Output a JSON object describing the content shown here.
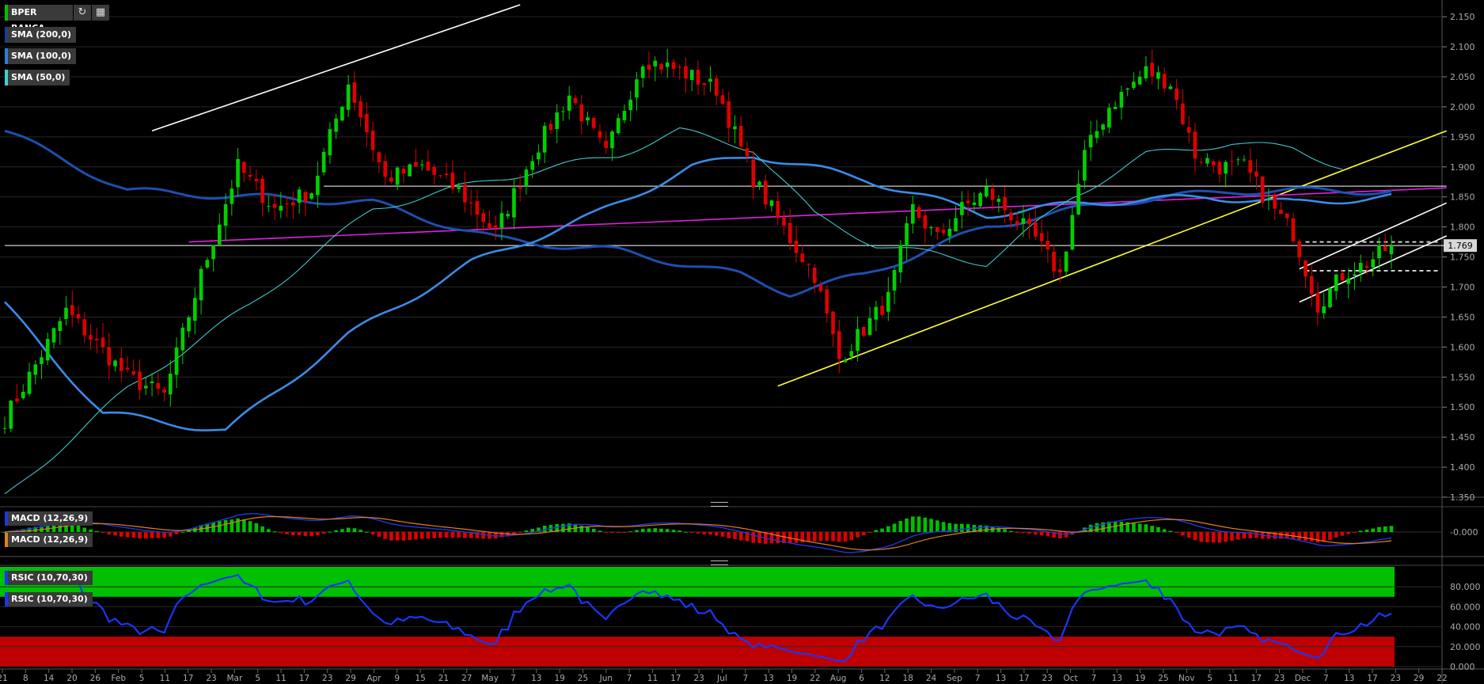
{
  "instrument": {
    "name": "BPER BANCA",
    "color": "#00c000",
    "current_price_label": "1.769",
    "refresh_icon": "refresh-icon",
    "calendar_icon": "calendar-icon"
  },
  "overlays": [
    {
      "label": "SMA (200,0)",
      "color": "#1e3f8a"
    },
    {
      "label": "SMA (100,0)",
      "color": "#2f7fd8"
    },
    {
      "label": "SMA (50,0)",
      "color": "#40d0d0"
    }
  ],
  "panels": {
    "macd": {
      "labels": [
        "MACD (12,26,9)",
        "MACD (12,26,9)"
      ],
      "zero_label": "-0.000",
      "colors": {
        "macd": "#2236e0",
        "signal": "#e08020",
        "hist_up": "#00c000",
        "hist_down": "#e00000"
      }
    },
    "rsi": {
      "labels": [
        "RSIC (10,70,30)",
        "RSIC (10,70,30)"
      ],
      "ticks": [
        "80.000",
        "60.000",
        "40.000",
        "20.000",
        "0.000"
      ],
      "overbought": 70,
      "oversold": 30,
      "colors": {
        "line": "#1a35ff",
        "overbought": "#00c000",
        "oversold": "#c00000"
      }
    }
  },
  "chart_data": {
    "type": "candlestick",
    "title": "BPER BANCA",
    "ylim": [
      1.35,
      2.17
    ],
    "y_ticks": [
      "2.150",
      "2.100",
      "2.050",
      "2.000",
      "1.950",
      "1.900",
      "1.850",
      "1.800",
      "1.750",
      "1.700",
      "1.650",
      "1.600",
      "1.550",
      "1.500",
      "1.450",
      "1.400",
      "1.350"
    ],
    "x_tick_labels": [
      "21",
      "8",
      "14",
      "20",
      "26",
      "Feb",
      "5",
      "11",
      "17",
      "23",
      "Mar",
      "5",
      "11",
      "17",
      "23",
      "29",
      "Apr",
      "9",
      "15",
      "21",
      "27",
      "May",
      "7",
      "13",
      "19",
      "25",
      "Jun",
      "7",
      "11",
      "17",
      "23",
      "Jul",
      "7",
      "13",
      "19",
      "22",
      "Aug",
      "6",
      "12",
      "18",
      "24",
      "Sep",
      "7",
      "13",
      "17",
      "23",
      "Oct",
      "7",
      "13",
      "19",
      "25",
      "Nov",
      "5",
      "11",
      "17",
      "23",
      "Dec",
      "7",
      "13",
      "17",
      "23",
      "29",
      "22"
    ],
    "price_path": [
      [
        0,
        1.48
      ],
      [
        10,
        1.66
      ],
      [
        20,
        1.55
      ],
      [
        26,
        1.52
      ],
      [
        32,
        1.72
      ],
      [
        38,
        1.9
      ],
      [
        44,
        1.83
      ],
      [
        50,
        1.86
      ],
      [
        56,
        2.04
      ],
      [
        62,
        1.88
      ],
      [
        68,
        1.9
      ],
      [
        74,
        1.86
      ],
      [
        80,
        1.79
      ],
      [
        86,
        1.92
      ],
      [
        92,
        2.02
      ],
      [
        98,
        1.92
      ],
      [
        104,
        2.08
      ],
      [
        110,
        2.06
      ],
      [
        116,
        2.03
      ],
      [
        122,
        1.88
      ],
      [
        128,
        1.78
      ],
      [
        132,
        1.72
      ],
      [
        136,
        1.58
      ],
      [
        140,
        1.63
      ],
      [
        144,
        1.68
      ],
      [
        148,
        1.83
      ],
      [
        152,
        1.78
      ],
      [
        156,
        1.83
      ],
      [
        160,
        1.86
      ],
      [
        164,
        1.82
      ],
      [
        168,
        1.78
      ],
      [
        172,
        1.72
      ],
      [
        176,
        1.92
      ],
      [
        180,
        2.0
      ],
      [
        186,
        2.06
      ],
      [
        190,
        2.04
      ],
      [
        194,
        1.92
      ],
      [
        198,
        1.9
      ],
      [
        202,
        1.9
      ],
      [
        206,
        1.84
      ],
      [
        210,
        1.79
      ],
      [
        214,
        1.67
      ],
      [
        218,
        1.72
      ],
      [
        222,
        1.74
      ],
      [
        226,
        1.77
      ]
    ],
    "current_price": 1.769,
    "series": [
      {
        "name": "SMA (200,0)",
        "points": [
          [
            0,
            1.96
          ],
          [
            20,
            1.86
          ],
          [
            40,
            1.85
          ],
          [
            60,
            1.84
          ],
          [
            80,
            1.78
          ],
          [
            100,
            1.76
          ],
          [
            120,
            1.72
          ],
          [
            128,
            1.69
          ],
          [
            140,
            1.72
          ],
          [
            160,
            1.8
          ],
          [
            180,
            1.84
          ],
          [
            200,
            1.86
          ],
          [
            226,
            1.86
          ]
        ]
      },
      {
        "name": "SMA (100,0)",
        "points": [
          [
            0,
            1.67
          ],
          [
            16,
            1.49
          ],
          [
            36,
            1.46
          ],
          [
            56,
            1.62
          ],
          [
            76,
            1.74
          ],
          [
            96,
            1.82
          ],
          [
            112,
            1.9
          ],
          [
            122,
            1.92
          ],
          [
            140,
            1.88
          ],
          [
            160,
            1.82
          ],
          [
            176,
            1.84
          ],
          [
            196,
            1.85
          ],
          [
            210,
            1.84
          ],
          [
            226,
            1.85
          ]
        ]
      },
      {
        "name": "SMA (50,0)",
        "points": [
          [
            0,
            1.35
          ],
          [
            20,
            1.53
          ],
          [
            40,
            1.67
          ],
          [
            60,
            1.83
          ],
          [
            80,
            1.88
          ],
          [
            100,
            1.92
          ],
          [
            110,
            1.96
          ],
          [
            122,
            1.93
          ],
          [
            132,
            1.82
          ],
          [
            142,
            1.77
          ],
          [
            160,
            1.74
          ],
          [
            174,
            1.85
          ],
          [
            186,
            1.92
          ],
          [
            200,
            1.94
          ],
          [
            210,
            1.93
          ],
          [
            218,
            1.9
          ]
        ]
      }
    ],
    "trendlines": [
      {
        "color": "#ffffff",
        "from": [
          24,
          1.96
        ],
        "to": [
          84,
          2.17
        ]
      },
      {
        "color": "#ffff33",
        "from": [
          126,
          1.535
        ],
        "to": [
          235,
          1.96
        ]
      },
      {
        "color": "#e020e0",
        "from": [
          30,
          1.775
        ],
        "to": [
          235,
          1.865
        ]
      },
      {
        "color": "#ffffff",
        "from": [
          52,
          1.868
        ],
        "to": [
          235,
          1.868
        ]
      },
      {
        "color": "#ffffff",
        "from": [
          0,
          1.769
        ],
        "to": [
          235,
          1.769
        ]
      },
      {
        "color": "#ffffff",
        "from": [
          211,
          1.675
        ],
        "to": [
          235,
          1.785
        ]
      },
      {
        "color": "#ffffff",
        "from": [
          211,
          1.73
        ],
        "to": [
          235,
          1.84
        ]
      }
    ],
    "dashed_levels": [
      1.775,
      1.727
    ]
  }
}
